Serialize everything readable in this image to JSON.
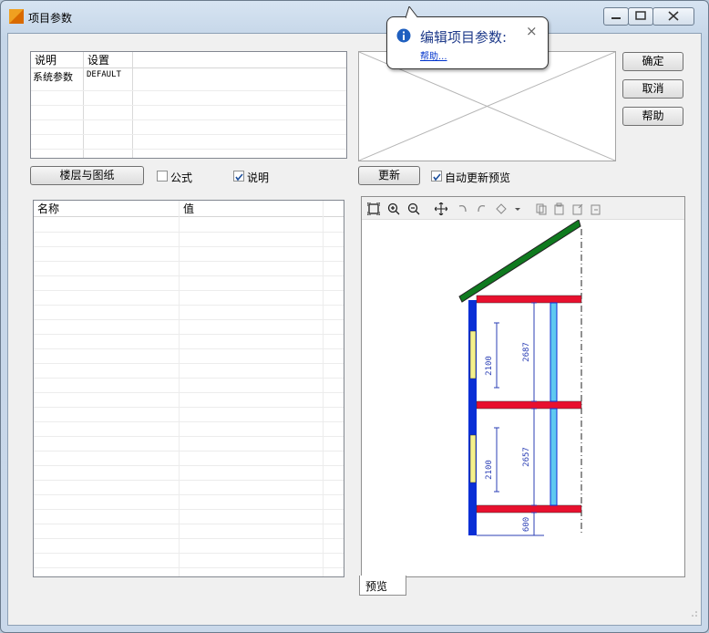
{
  "window": {
    "title": "项目参数"
  },
  "balloon": {
    "title": "编辑项目参数:",
    "link": "帮助...",
    "close": "×"
  },
  "params_table": {
    "headers": [
      "说明",
      "设置"
    ],
    "rows": [
      {
        "desc": "系统参数",
        "value": "DEFAULT"
      }
    ]
  },
  "buttons": {
    "floors": "楼层与图纸",
    "update": "更新",
    "ok": "确定",
    "cancel": "取消",
    "help": "帮助"
  },
  "options": {
    "formula": {
      "label": "公式",
      "checked": false
    },
    "description": {
      "label": "说明",
      "checked": true
    },
    "auto_preview": {
      "label": "自动更新预览",
      "checked": true
    }
  },
  "properties_table": {
    "headers": [
      "名称",
      "值"
    ]
  },
  "preview": {
    "tab": "预览",
    "dimensions": [
      "2100",
      "2687",
      "2100",
      "2657",
      "600"
    ]
  },
  "colors": {
    "wall": "#0a2fd6",
    "slab": "#e8102e",
    "roof": "#0f7a1f",
    "window": "#f4f08a",
    "column": "#5fc9f0"
  }
}
